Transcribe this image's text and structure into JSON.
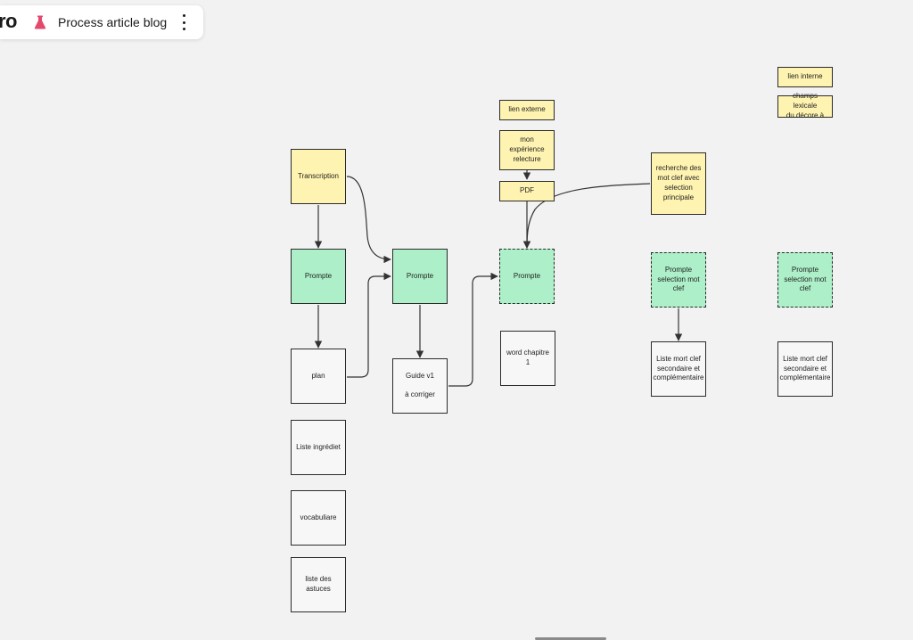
{
  "header": {
    "brand_partial": "ro",
    "board_title": "Process article blog",
    "board_icon": "flask-icon",
    "menu_icon": "more-vertical-icon"
  },
  "colors": {
    "yellow_sticky": "#fef3b0",
    "green_sticky": "#acefc8",
    "white_card": "#f7f7f7",
    "canvas": "#f2f2f2",
    "flask": "#e5486d"
  },
  "nodes": {
    "transcription": "Transcription",
    "prompte_1": "Prompte",
    "prompte_2": "Prompte",
    "prompte_3": "Prompte",
    "plan": "plan",
    "guide": "Guide v1\n\nà corriger",
    "liste_ingrediet": "Liste ingrédiet",
    "vocabuliare": "vocabuliare",
    "liste_astuces": "liste des astuces",
    "lien_externe": "lien  externe",
    "mon_experience": "mon expérience\nrelecture",
    "pdf": "PDF",
    "word_chapitre": "word chapitre 1",
    "recherche": "recherche des\nmot clef avec\nselection\nprincipale",
    "prompte_sel_1": "Prompte\nselection mot\nclef",
    "prompte_sel_2": "Prompte\nselection mot\nclef",
    "liste_mot_1": "Liste mort clef\nsecondaire et\ncomplémentaire",
    "liste_mot_2": "Liste mort clef\nsecondaire et\ncomplémentaire",
    "lien_interne": "lien  interne",
    "champs_lexicale": "champs lexicale\ndu décore à"
  }
}
